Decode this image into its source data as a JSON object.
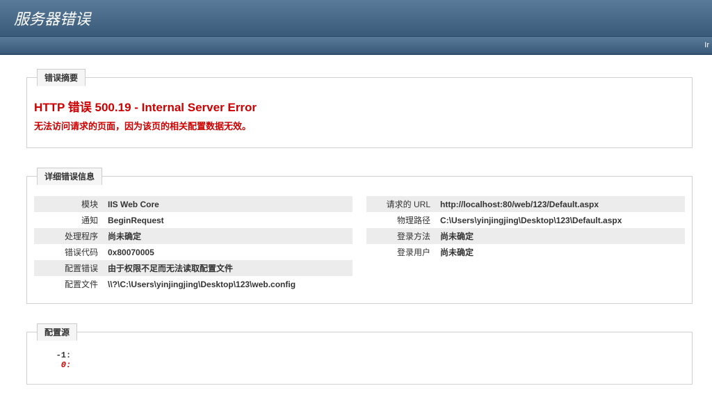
{
  "header": {
    "title": "服务器错误",
    "bar_right": "Ir"
  },
  "summary": {
    "legend": "错误摘要",
    "title": "HTTP 错误 500.19 - Internal Server Error",
    "subtitle": "无法访问请求的页面，因为该页的相关配置数据无效。"
  },
  "details": {
    "legend": "详细错误信息",
    "left": {
      "module_label": "模块",
      "module_value": "IIS Web Core",
      "notification_label": "通知",
      "notification_value": "BeginRequest",
      "handler_label": "处理程序",
      "handler_value": "尚未确定",
      "errorcode_label": "错误代码",
      "errorcode_value": "0x80070005",
      "configerror_label": "配置错误",
      "configerror_value": "由于权限不足而无法读取配置文件",
      "configfile_label": "配置文件",
      "configfile_value": "\\\\?\\C:\\Users\\yinjingjing\\Desktop\\123\\web.config"
    },
    "right": {
      "requrl_label": "请求的 URL",
      "requrl_value": "http://localhost:80/web/123/Default.aspx",
      "physpath_label": "物理路径",
      "physpath_value": "C:\\Users\\yinjingjing\\Desktop\\123\\Default.aspx",
      "logon_label": "登录方法",
      "logon_value": "尚未确定",
      "logonuser_label": "登录用户",
      "logonuser_value": "尚未确定"
    }
  },
  "configsource": {
    "legend": "配置源",
    "line_neg1_label": "   -1: ",
    "line_0_label": "    0: "
  }
}
